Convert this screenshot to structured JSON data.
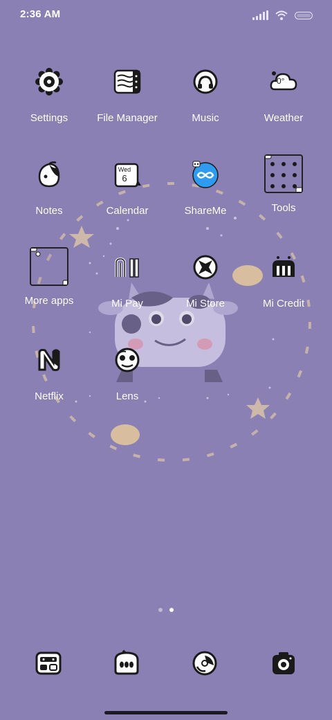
{
  "status_bar": {
    "time": "2:36 AM"
  },
  "apps": [
    {
      "label": "Settings",
      "icon": "gear-icon"
    },
    {
      "label": "File Manager",
      "icon": "folder-icon"
    },
    {
      "label": "Music",
      "icon": "music-icon"
    },
    {
      "label": "Weather",
      "icon": "weather-icon",
      "icon_text": "0°"
    },
    {
      "label": "Notes",
      "icon": "notes-icon"
    },
    {
      "label": "Calendar",
      "icon": "calendar-icon",
      "icon_day": "Wed",
      "icon_date": "6"
    },
    {
      "label": "ShareMe",
      "icon": "shareme-icon"
    },
    {
      "label": "Tools",
      "icon": "tools-folder-icon"
    },
    {
      "label": "More apps",
      "icon": "more-apps-folder-icon"
    },
    {
      "label": "Mi Pay",
      "icon": "mi-pay-icon"
    },
    {
      "label": "Mi Store",
      "icon": "mi-store-icon"
    },
    {
      "label": "Mi Credit",
      "icon": "mi-credit-icon"
    },
    {
      "label": "Netflix",
      "icon": "netflix-icon"
    },
    {
      "label": "Lens",
      "icon": "lens-icon"
    }
  ],
  "dock": [
    {
      "icon": "phone-icon"
    },
    {
      "icon": "messages-icon"
    },
    {
      "icon": "browser-icon"
    },
    {
      "icon": "camera-icon"
    }
  ],
  "page_indicator": {
    "pages": 2,
    "current": 2
  },
  "colors": {
    "background": "#8a80b3",
    "icon_stroke": "#1a1a1a",
    "label": "#ffffff"
  }
}
